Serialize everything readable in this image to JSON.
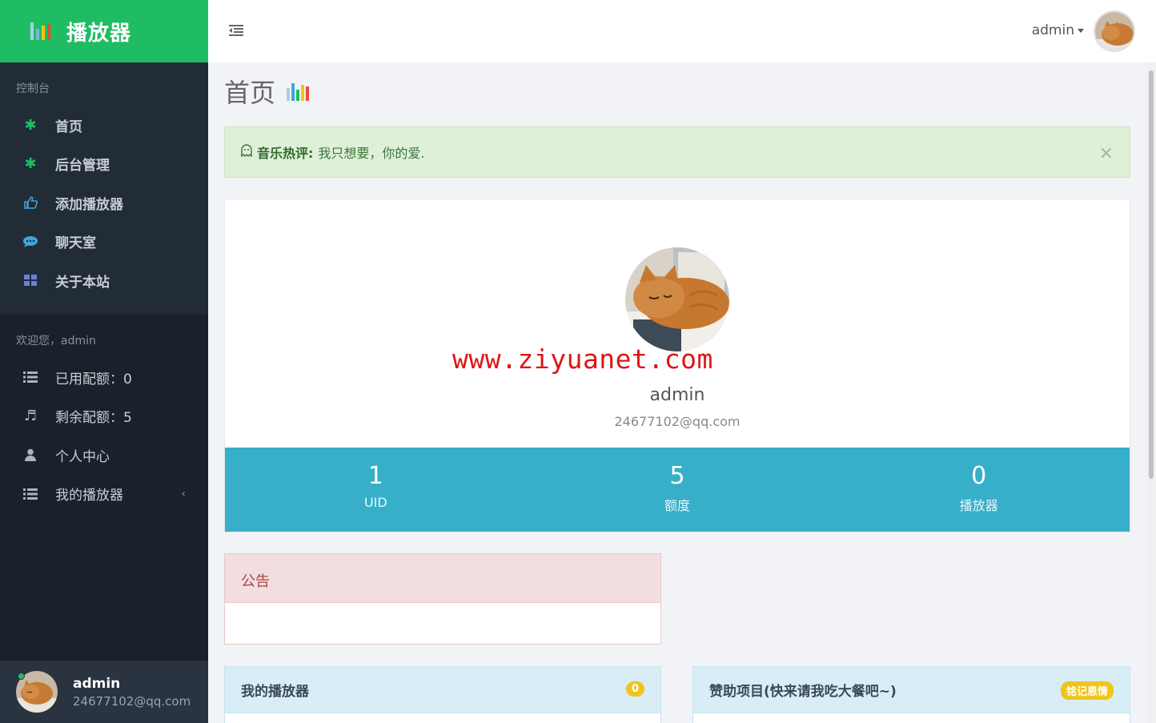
{
  "brand": {
    "title": "播放器"
  },
  "sidebar": {
    "section_console": "控制台",
    "nav": [
      {
        "label": "首页",
        "icon": "asterisk-icon"
      },
      {
        "label": "后台管理",
        "icon": "asterisk-icon"
      },
      {
        "label": "添加播放器",
        "icon": "thumbs-up-icon"
      },
      {
        "label": "聊天室",
        "icon": "chat-bubble-icon"
      },
      {
        "label": "关于本站",
        "icon": "grid-icon"
      }
    ],
    "section_welcome": "欢迎您，admin",
    "account": [
      {
        "label": "已用配额：0",
        "icon": "list-icon"
      },
      {
        "label": "剩余配额：5",
        "icon": "music-note-icon"
      },
      {
        "label": "个人中心",
        "icon": "user-icon"
      },
      {
        "label": "我的播放器",
        "icon": "list-icon"
      }
    ],
    "user": {
      "name": "admin",
      "email": "24677102@qq.com"
    }
  },
  "topbar": {
    "username": "admin"
  },
  "page": {
    "title": "首页"
  },
  "alert": {
    "label": "音乐热评:",
    "text": "我只想要，你的爱."
  },
  "profile": {
    "watermark": "www.ziyuanet.com",
    "name": "admin",
    "email": "24677102@qq.com",
    "stats": [
      {
        "value": "1",
        "label": "UID"
      },
      {
        "value": "5",
        "label": "额度"
      },
      {
        "value": "0",
        "label": "播放器"
      }
    ]
  },
  "notice": {
    "title": "公告"
  },
  "my_players": {
    "title": "我的播放器",
    "badge": "0"
  },
  "sponsor": {
    "title": "赞助项目(快来请我吃大餐吧~)",
    "badge": "铭记恩情"
  },
  "colors": {
    "brand_green": "#1fbc63",
    "sidebar_dark": "#1f2731",
    "stats_blue": "#37afc9",
    "alert_green_bg": "#dff0d8",
    "notice_red_bg": "#f2dede",
    "info_blue_bg": "#d9edf7",
    "badge_yellow": "#f0c419"
  }
}
